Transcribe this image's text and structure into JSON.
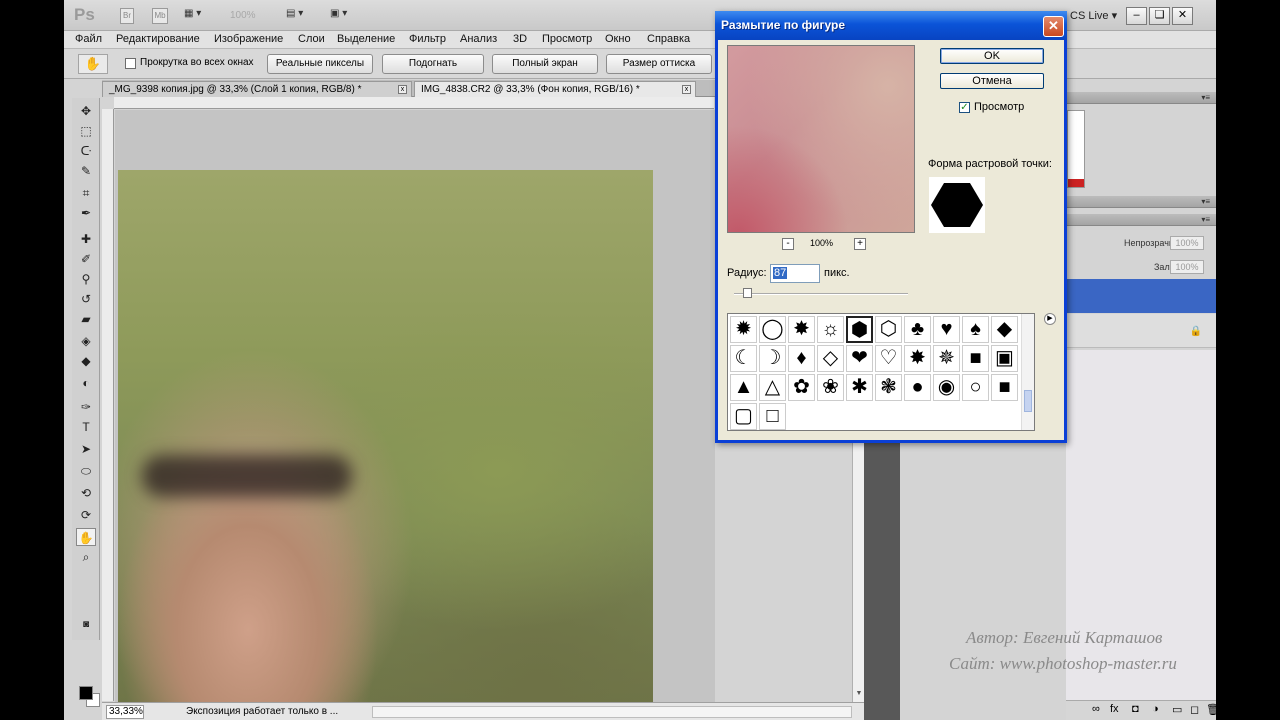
{
  "app": {
    "logo": "Ps",
    "zoom": "100%",
    "cs_live": "CS Live ▾",
    "window_buttons": [
      "–",
      "❏",
      "✕"
    ]
  },
  "menu": [
    "Файл",
    "Редактирование",
    "Изображение",
    "Слои",
    "Выделение",
    "Фильтр",
    "Анализ",
    "3D",
    "Просмотр",
    "Окно",
    "Справка"
  ],
  "options": {
    "scroll_all": "Прокрутка во всех окнах",
    "buttons": [
      "Реальные пикселы",
      "Подогнать",
      "Полный экран",
      "Размер оттиска"
    ]
  },
  "tabs": [
    {
      "label": "_MG_9398 копия.jpg @ 33,3% (Слой 1 копия, RGB/8) *",
      "close": "x"
    },
    {
      "label": "IMG_4838.CR2 @ 33,3% (Фон копия, RGB/16) *",
      "close": "x"
    }
  ],
  "status": {
    "zoom": "33,33%",
    "info": "Экспозиция работает только в ..."
  },
  "layers": {
    "opacity_label": "Непрозрачность:",
    "opacity_value": "100%",
    "fill_label": "Заливка:",
    "fill_value": "100%"
  },
  "credits": {
    "author": "Автор: Евгений Карташов",
    "site": "Сайт: www.photoshop-master.ru"
  },
  "dialog": {
    "title": "Размытие по фигуре",
    "ok": "OK",
    "cancel": "Отмена",
    "preview_label": "Просмотр",
    "preview_checked": true,
    "zoom_minus": "-",
    "zoom_value": "100%",
    "zoom_plus": "+",
    "shape_label": "Форма растровой точки:",
    "radius_label": "Радиус:",
    "radius_value": "87",
    "radius_unit": "пикс.",
    "shapes": [
      {
        "name": "splat-shape",
        "glyph": "✹"
      },
      {
        "name": "ring-shape",
        "glyph": "◯"
      },
      {
        "name": "star-burst-shape",
        "glyph": "✸"
      },
      {
        "name": "sun-shape",
        "glyph": "☼"
      },
      {
        "name": "hexagon-shape",
        "glyph": "⬢"
      },
      {
        "name": "hexagon-outline-shape",
        "glyph": "⬡"
      },
      {
        "name": "club-shape",
        "glyph": "♣"
      },
      {
        "name": "heart-shape",
        "glyph": "♥"
      },
      {
        "name": "spade-shape",
        "glyph": "♠"
      },
      {
        "name": "diamond-shape",
        "glyph": "◆"
      },
      {
        "name": "crescent-shape",
        "glyph": "☾"
      },
      {
        "name": "crescent-outline-shape",
        "glyph": "☽"
      },
      {
        "name": "rhombus-shape",
        "glyph": "♦"
      },
      {
        "name": "rhombus-outline-shape",
        "glyph": "◇"
      },
      {
        "name": "heart-solid-shape",
        "glyph": "❤"
      },
      {
        "name": "heart-outline-shape",
        "glyph": "♡"
      },
      {
        "name": "eight-point-star-shape",
        "glyph": "✸"
      },
      {
        "name": "eight-point-outline-shape",
        "glyph": "✵"
      },
      {
        "name": "rounded-square-shape",
        "glyph": "■"
      },
      {
        "name": "rounded-square-outline-shape",
        "glyph": "▣"
      },
      {
        "name": "triangle-shape",
        "glyph": "▲"
      },
      {
        "name": "triangle-outline-shape",
        "glyph": "△"
      },
      {
        "name": "blob-shape",
        "glyph": "✿"
      },
      {
        "name": "blob-outline-shape",
        "glyph": "❀"
      },
      {
        "name": "asterisk-shape",
        "glyph": "✱"
      },
      {
        "name": "flower-outline-shape",
        "glyph": "❃"
      },
      {
        "name": "circle-shape",
        "glyph": "●"
      },
      {
        "name": "thick-ring-shape",
        "glyph": "◉"
      },
      {
        "name": "circle-outline-shape",
        "glyph": "○"
      },
      {
        "name": "square-shape",
        "glyph": "■"
      },
      {
        "name": "square-frame-shape",
        "glyph": "▢"
      },
      {
        "name": "square-outline-shape",
        "glyph": "□"
      }
    ]
  }
}
